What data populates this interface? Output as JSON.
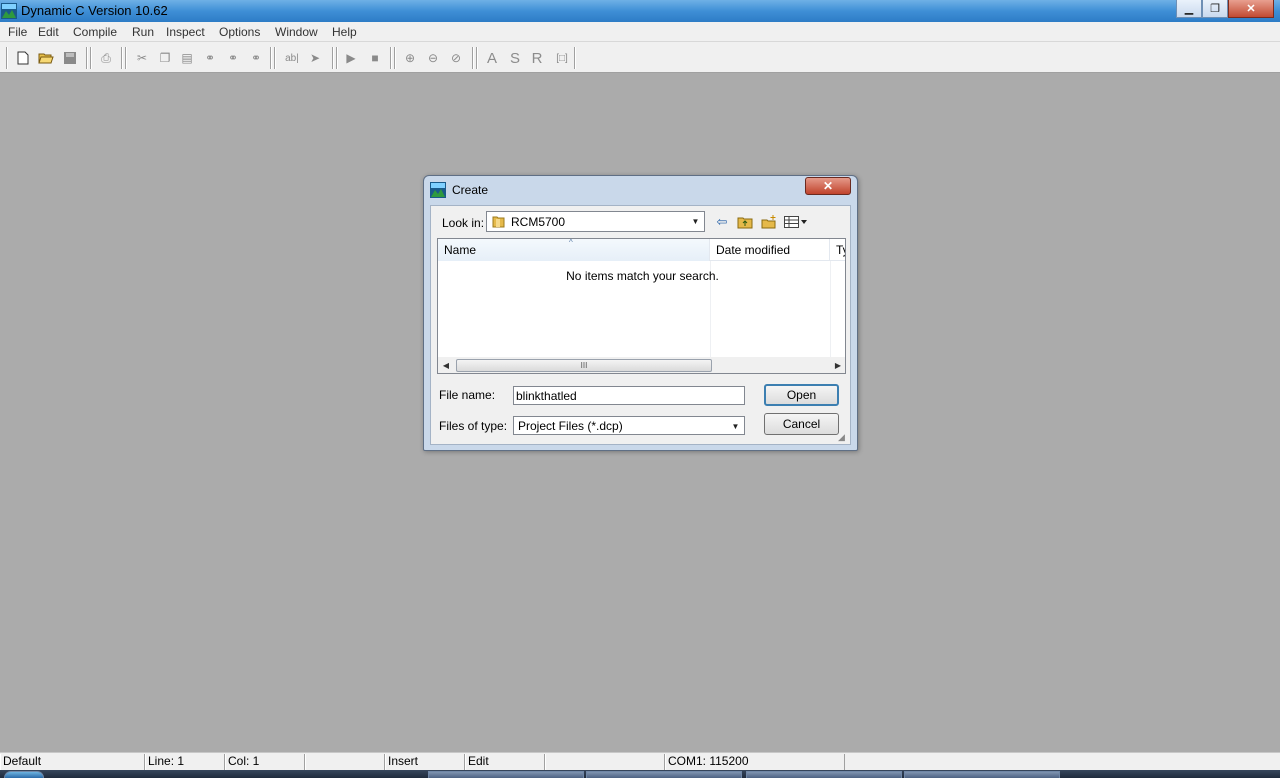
{
  "window": {
    "title": "Dynamic C Version 10.62"
  },
  "menubar": {
    "items": [
      "File",
      "Edit",
      "Compile",
      "Run",
      "Inspect",
      "Options",
      "Window",
      "Help"
    ]
  },
  "toolbar": {
    "letters": [
      "A",
      "S",
      "R"
    ]
  },
  "dialog": {
    "title": "Create",
    "look_in_label": "Look in:",
    "look_in_value": "RCM5700",
    "columns": [
      "Name",
      "Date modified",
      "Ty"
    ],
    "empty_message": "No items match your search.",
    "file_name_label": "File name:",
    "file_name_value": "blinkthatled",
    "files_of_type_label": "Files of type:",
    "files_of_type_value": "Project Files (*.dcp)",
    "open_label": "Open",
    "cancel_label": "Cancel",
    "scroll_thumb_glyph": "III"
  },
  "statusbar": {
    "mode": "Default",
    "line": "Line: 1",
    "col": "Col: 1",
    "insert": "Insert",
    "edit": "Edit",
    "com": "COM1: 115200"
  },
  "colors": {
    "workspace": "#ababab",
    "titlebar": "#3f8fd6",
    "dialog_frame": "#c9d8ea"
  }
}
